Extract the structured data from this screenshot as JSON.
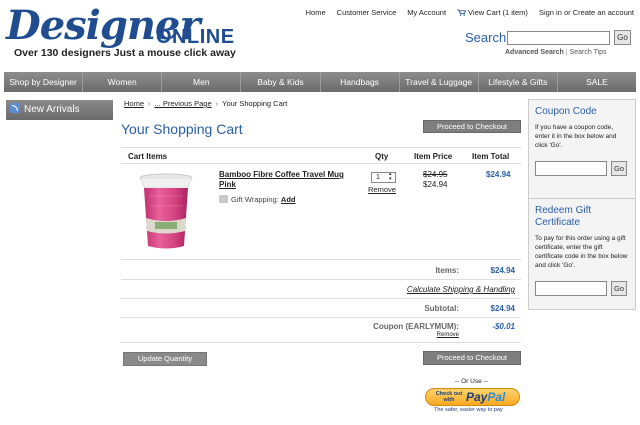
{
  "brand": {
    "name": "Designer",
    "suffix": "ONLINE",
    "tagline": "Over 130 designers  Just a mouse click away"
  },
  "top_nav": {
    "home": "Home",
    "customer_service": "Customer Service",
    "my_account": "My Account",
    "view_cart": "View Cart (1 item)",
    "sign_in": "Sign in or Create an account"
  },
  "search": {
    "label": "Search",
    "value": "",
    "go": "Go",
    "advanced": "Advanced Search",
    "separator": "|",
    "tips": "Search Tips"
  },
  "categories": [
    "Shop by Designer",
    "Women",
    "Men",
    "Baby & Kids",
    "Handbags",
    "Travel & Luggage",
    "Lifestyle & Gifts",
    "SALE"
  ],
  "sidebar": {
    "new_arrivals": "New Arrivals"
  },
  "breadcrumb": {
    "home": "Home",
    "previous": "... Previous Page",
    "current": "Your Shopping Cart",
    "separator": "›"
  },
  "cart": {
    "title": "Your Shopping Cart",
    "checkout_label": "Proceed to Checkout",
    "columns": {
      "items": "Cart Items",
      "qty": "Qty",
      "price": "Item Price",
      "total": "Item Total"
    },
    "items": [
      {
        "name": "Bamboo Fibre Coffee Travel Mug Pink",
        "gift_wrapping_label": "Gift Wrapping:",
        "gift_wrapping_action": "Add",
        "qty": "1",
        "remove": "Remove",
        "price_old": "$24.95",
        "price_new": "$24.94",
        "total": "$24.94"
      }
    ],
    "summary": {
      "items_label": "Items:",
      "items_value": "$24.94",
      "shipping_link": "Calculate Shipping & Handling",
      "subtotal_label": "Subtotal:",
      "subtotal_value": "$24.94",
      "coupon_label": "Coupon (EARLYMUM):",
      "coupon_value": "-$0.01",
      "coupon_remove": "Remove"
    },
    "update_quantity": "Update Quantity",
    "or_use": "-- Or Use --",
    "paypal": {
      "check_out": "Check out with",
      "brand_pay": "Pay",
      "brand_pal": "Pal",
      "tagline": "The safer, easier way to pay"
    }
  },
  "coupon_box": {
    "title": "Coupon Code",
    "text": "If you have a coupon code, enter it in the box below and click 'Go'.",
    "value": "",
    "go": "Go"
  },
  "gift_box": {
    "title": "Redeem Gift Certificate",
    "text": "To pay for this order using a gift certificate, enter the gift certificate code in the box below and click 'Go'.",
    "value": "",
    "go": "Go"
  },
  "colors": {
    "accent_blue": "#2a5da8",
    "nav_grey": "#7a7a7a",
    "mug_pink": "#e0508f"
  }
}
